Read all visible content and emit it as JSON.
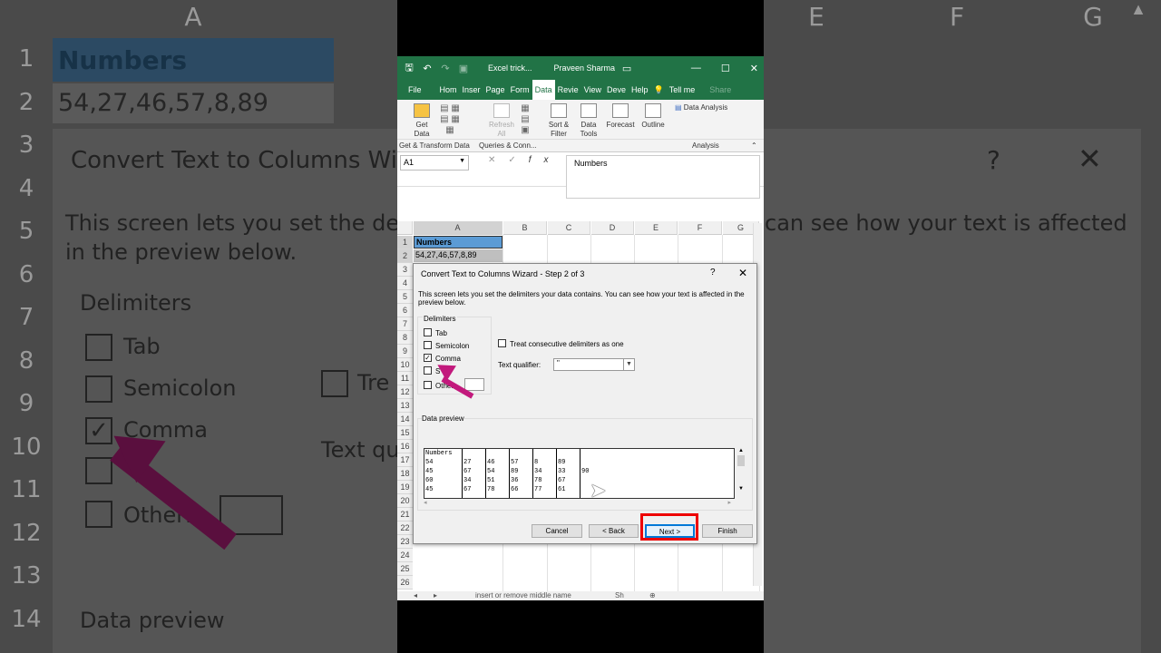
{
  "background": {
    "col_headers": [
      "A",
      "E",
      "F",
      "G"
    ],
    "row_headers": [
      "1",
      "2",
      "3",
      "4",
      "5",
      "6",
      "7",
      "8",
      "9",
      "10",
      "11",
      "12",
      "13",
      "14"
    ],
    "cell_a1": "Numbers",
    "cell_a2": "54,27,46,57,8,89",
    "dialog_title": "Convert Text to Columns Wiz",
    "desc_left": "This screen lets you set the de",
    "desc_left2": "in the preview below.",
    "desc_right": "can see how your text is affected",
    "delimiters_label": "Delimiters",
    "tab": "Tab",
    "semicolon": "Semicolon",
    "comma": "Comma",
    "other": "Other:",
    "treat_partial": "Tre",
    "text_qual_partial": "Text qu",
    "data_preview": "Data preview",
    "help": "?",
    "close": "✕"
  },
  "titlebar": {
    "workbook": "Excel trick...",
    "user": "Praveen Sharma"
  },
  "menu": [
    "File",
    "Hom",
    "Inser",
    "Page",
    "Form",
    "Data",
    "Revie",
    "View",
    "Deve",
    "Help",
    "Tell me",
    "Share"
  ],
  "ribbon": {
    "get_data": "Get Data",
    "refresh_all": "Refresh All",
    "sort_filter": "Sort & Filter",
    "data_tools": "Data Tools",
    "forecast": "Forecast",
    "outline": "Outline",
    "data_analysis": "Data Analysis",
    "group_get": "Get & Transform Data",
    "group_queries": "Queries & Conn...",
    "group_analysis": "Analysis"
  },
  "formula_bar": {
    "name_box": "A1",
    "content": "Numbers"
  },
  "sheet": {
    "columns": [
      "A",
      "B",
      "C",
      "D",
      "E",
      "F",
      "G"
    ],
    "rows": [
      "1",
      "2",
      "3",
      "4",
      "5",
      "6",
      "7",
      "8",
      "9",
      "10",
      "11",
      "12",
      "13",
      "14",
      "15",
      "16",
      "17",
      "18",
      "19",
      "20",
      "21",
      "22",
      "23",
      "24",
      "25",
      "26"
    ],
    "a1": "Numbers",
    "a2": "54,27,46,57,8,89"
  },
  "sheet_bar": {
    "tab_label": "insert or remove middle name",
    "sheet_abbrev": "Sh"
  },
  "wizard": {
    "title": "Convert Text to Columns Wizard - Step 2 of 3",
    "help": "?",
    "close": "✕",
    "description": "This screen lets you set the delimiters your data contains.  You can see how your text is affected in the preview below.",
    "delimiters_label": "Delimiters",
    "tab": "Tab",
    "semicolon": "Semicolon",
    "comma": "Comma",
    "space": "S",
    "other": "Other:",
    "comma_checked": true,
    "treat_consecutive": "Treat consecutive delimiters as one",
    "text_qualifier_label": "Text qualifier:",
    "text_qualifier_value": "\"",
    "data_preview_label": "Data preview",
    "preview_columns": [
      [
        "Numbers",
        "54",
        "45",
        "60",
        "45"
      ],
      [
        "",
        "27",
        "67",
        "34",
        "67"
      ],
      [
        "",
        "46",
        "54",
        "51",
        "78"
      ],
      [
        "",
        "57",
        "89",
        "36",
        "66"
      ],
      [
        "",
        "8",
        "34",
        "78",
        "77"
      ],
      [
        "",
        "89",
        "33",
        "67",
        "61"
      ],
      [
        "",
        "",
        "90",
        "",
        ""
      ]
    ],
    "cancel": "Cancel",
    "back": "< Back",
    "next": "Next >",
    "finish": "Finish"
  }
}
